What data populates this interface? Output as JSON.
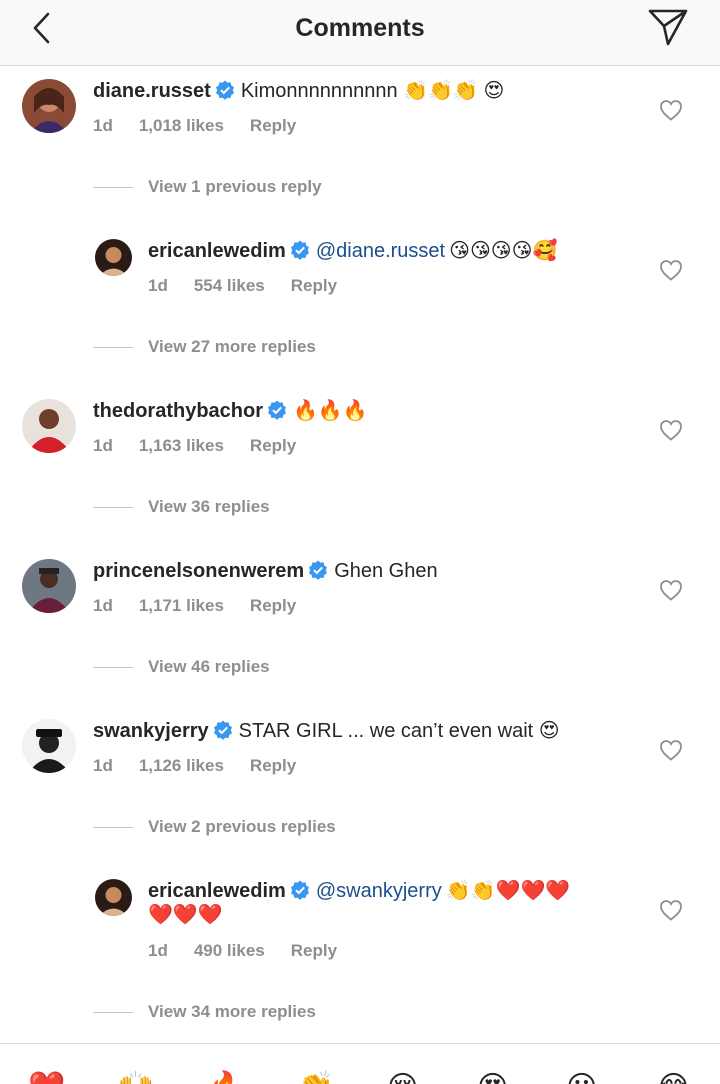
{
  "header": {
    "title": "Comments",
    "back_icon": "chevron-left-icon",
    "send_icon": "paper-plane-icon"
  },
  "comments": [
    {
      "username": "diane.russet",
      "text": "Kimonnnnnnnnnn 👏👏👏 😍",
      "time": "1d",
      "likes": "1,018 likes",
      "reply": "Reply",
      "view_text": "View 1 previous reply"
    },
    {
      "username": "ericanlewedim",
      "mention": "@diane.russet",
      "text": "😘😘😘😘🥰",
      "time": "1d",
      "likes": "554 likes",
      "reply": "Reply",
      "view_text": "View 27 more replies"
    },
    {
      "username": "thedorathybachor",
      "text": "🔥🔥🔥",
      "time": "1d",
      "likes": "1,163 likes",
      "reply": "Reply",
      "view_text": "View 36 replies"
    },
    {
      "username": "princenelsonenwerem",
      "text": "Ghen Ghen",
      "time": "1d",
      "likes": "1,171 likes",
      "reply": "Reply",
      "view_text": "View 46 replies"
    },
    {
      "username": "swankyjerry",
      "text": "STAR GIRL ... we can’t even wait 😍",
      "time": "1d",
      "likes": "1,126 likes",
      "reply": "Reply",
      "view_text": "View 2 previous replies"
    },
    {
      "username": "ericanlewedim",
      "mention": "@swankyjerry",
      "text": "👏👏❤️❤️❤️",
      "text2": "❤️❤️❤️",
      "time": "1d",
      "likes": "490 likes",
      "reply": "Reply",
      "view_text": "View 34 more replies"
    }
  ],
  "emoji_bar": [
    "❤️",
    "🙌",
    "🔥",
    "👏",
    "😢",
    "😍",
    "😮",
    "😂"
  ],
  "colors": {
    "verified": "#3897f0",
    "mention": "#1b4f8c",
    "meta": "#8e8e8e"
  }
}
